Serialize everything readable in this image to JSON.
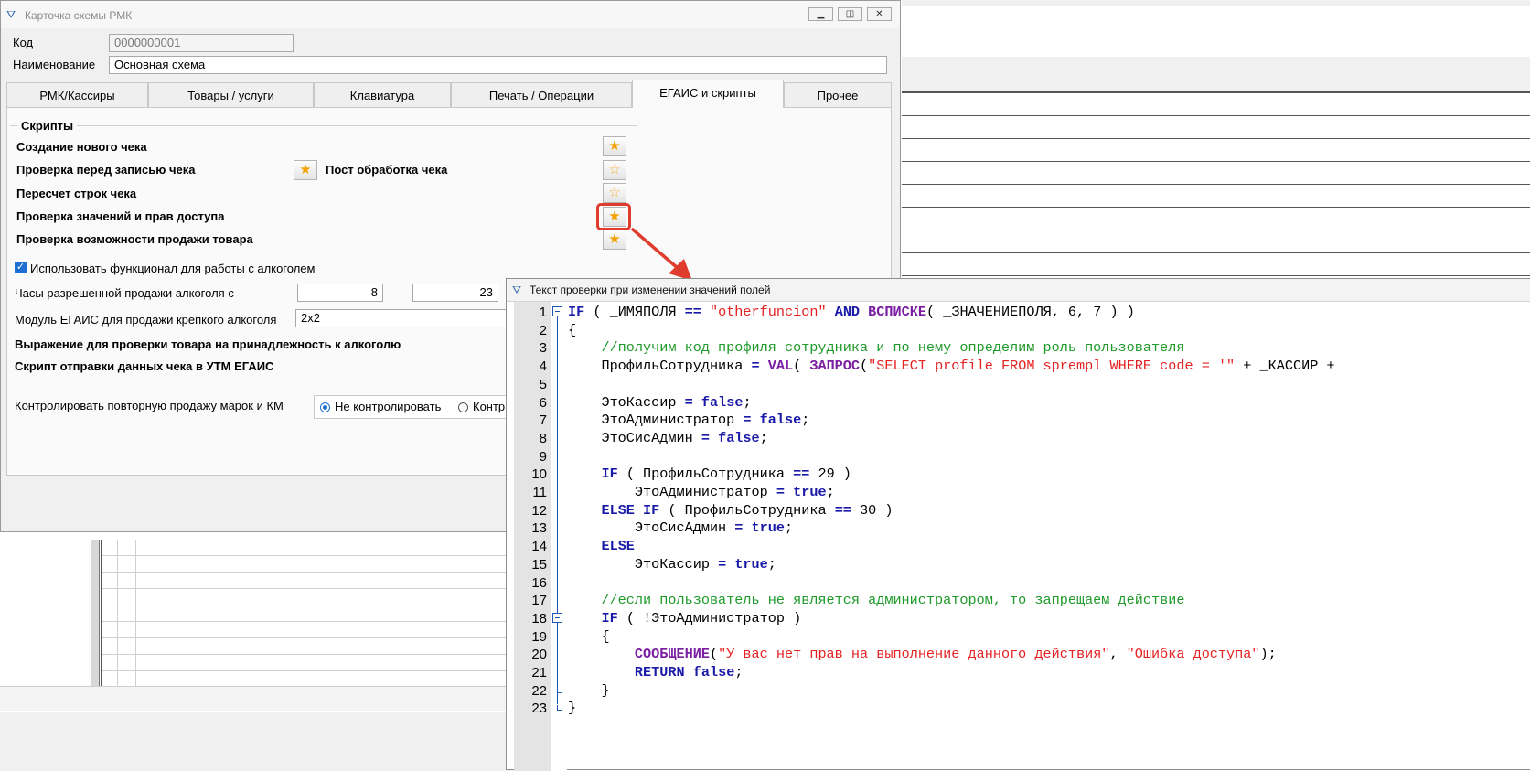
{
  "main_window": {
    "title": "Карточка схемы РМК",
    "code_label": "Код",
    "code_value": "0000000001",
    "name_label": "Наименование",
    "name_value": "Основная схема",
    "tabs": [
      "РМК/Кассиры",
      "Товары / услуги",
      "Клавиатура",
      "Печать / Операции",
      "ЕГАИС и скрипты",
      "Прочее"
    ],
    "active_tab": "ЕГАИС и скрипты",
    "scripts_group": "Скрипты",
    "scripts": [
      "Создание нового чека",
      "Проверка перед записью чека",
      "Пересчет строк чека",
      "Проверка значений и прав доступа",
      "Проверка возможности продажи товара"
    ],
    "post_processing_label": "Пост обработка чека",
    "alcohol_checkbox_label": "Использовать функционал для работы с алкоголем",
    "alcohol_checkbox_checked": true,
    "hours_label": "Часы разрешенной продажи алкоголя с",
    "hours_from": "8",
    "hours_to": "23",
    "module_label": "Модуль ЕГАИС для продажи крепкого алкоголя",
    "module_value": "2x2",
    "expr_label": "Выражение для проверки товара на принадлежность к алкоголю",
    "utm_label": "Скрипт отправки данных чека в УТМ ЕГАИС",
    "control_label": "Контролировать повторную продажу марок и КМ",
    "control_options": [
      "Не контролировать",
      "Контр"
    ],
    "control_selected": "Не контролировать"
  },
  "code_editor": {
    "title": "Текст проверки при изменении значений полей",
    "line_numbers": [
      "1",
      "2",
      "3",
      "4",
      "5",
      "6",
      "7",
      "8",
      "9",
      "10",
      "11",
      "12",
      "13",
      "14",
      "15",
      "16",
      "17",
      "18",
      "19",
      "20",
      "21",
      "22",
      "23"
    ],
    "lines": [
      [
        {
          "t": "IF",
          "c": "kw"
        },
        {
          "t": " ( _ИМЯПОЛЯ ",
          "c": ""
        },
        {
          "t": "==",
          "c": "op"
        },
        {
          "t": " ",
          "c": ""
        },
        {
          "t": "\"otherfuncion\"",
          "c": "str"
        },
        {
          "t": " ",
          "c": ""
        },
        {
          "t": "AND",
          "c": "kw"
        },
        {
          "t": " ",
          "c": ""
        },
        {
          "t": "ВСПИСКЕ",
          "c": "fn"
        },
        {
          "t": "( _ЗНАЧЕНИЕПОЛЯ, 6, 7 ) )",
          "c": ""
        }
      ],
      [
        {
          "t": "{",
          "c": ""
        }
      ],
      [
        {
          "t": "    //получим код профиля сотрудника и по нему определим роль пользователя",
          "c": "cmt"
        }
      ],
      [
        {
          "t": "    ПрофильСотрудника ",
          "c": ""
        },
        {
          "t": "=",
          "c": "op"
        },
        {
          "t": " ",
          "c": ""
        },
        {
          "t": "VAL",
          "c": "fn"
        },
        {
          "t": "( ",
          "c": ""
        },
        {
          "t": "ЗАПРОС",
          "c": "fn"
        },
        {
          "t": "(",
          "c": ""
        },
        {
          "t": "\"SELECT profile FROM sprempl WHERE code = '\"",
          "c": "str"
        },
        {
          "t": " + _КАССИР +",
          "c": ""
        }
      ],
      [
        {
          "t": "",
          "c": ""
        }
      ],
      [
        {
          "t": "    ЭтоКассир ",
          "c": ""
        },
        {
          "t": "=",
          "c": "op"
        },
        {
          "t": " ",
          "c": ""
        },
        {
          "t": "false",
          "c": "kw"
        },
        {
          "t": ";",
          "c": ""
        }
      ],
      [
        {
          "t": "    ЭтоАдминистратор ",
          "c": ""
        },
        {
          "t": "=",
          "c": "op"
        },
        {
          "t": " ",
          "c": ""
        },
        {
          "t": "false",
          "c": "kw"
        },
        {
          "t": ";",
          "c": ""
        }
      ],
      [
        {
          "t": "    ЭтоСисАдмин ",
          "c": ""
        },
        {
          "t": "=",
          "c": "op"
        },
        {
          "t": " ",
          "c": ""
        },
        {
          "t": "false",
          "c": "kw"
        },
        {
          "t": ";",
          "c": ""
        }
      ],
      [
        {
          "t": "",
          "c": ""
        }
      ],
      [
        {
          "t": "    ",
          "c": ""
        },
        {
          "t": "IF",
          "c": "kw"
        },
        {
          "t": " ( ПрофильСотрудника ",
          "c": ""
        },
        {
          "t": "==",
          "c": "op"
        },
        {
          "t": " 29 )",
          "c": ""
        }
      ],
      [
        {
          "t": "        ЭтоАдминистратор ",
          "c": ""
        },
        {
          "t": "=",
          "c": "op"
        },
        {
          "t": " ",
          "c": ""
        },
        {
          "t": "true",
          "c": "kw"
        },
        {
          "t": ";",
          "c": ""
        }
      ],
      [
        {
          "t": "    ",
          "c": ""
        },
        {
          "t": "ELSE IF",
          "c": "kw"
        },
        {
          "t": " ( ПрофильСотрудника ",
          "c": ""
        },
        {
          "t": "==",
          "c": "op"
        },
        {
          "t": " 30 )",
          "c": ""
        }
      ],
      [
        {
          "t": "        ЭтоСисАдмин ",
          "c": ""
        },
        {
          "t": "=",
          "c": "op"
        },
        {
          "t": " ",
          "c": ""
        },
        {
          "t": "true",
          "c": "kw"
        },
        {
          "t": ";",
          "c": ""
        }
      ],
      [
        {
          "t": "    ",
          "c": ""
        },
        {
          "t": "ELSE",
          "c": "kw"
        }
      ],
      [
        {
          "t": "        ЭтоКассир ",
          "c": ""
        },
        {
          "t": "=",
          "c": "op"
        },
        {
          "t": " ",
          "c": ""
        },
        {
          "t": "true",
          "c": "kw"
        },
        {
          "t": ";",
          "c": ""
        }
      ],
      [
        {
          "t": "",
          "c": ""
        }
      ],
      [
        {
          "t": "    //если пользователь не является администратором, то запрещаем действие",
          "c": "cmt"
        }
      ],
      [
        {
          "t": "    ",
          "c": ""
        },
        {
          "t": "IF",
          "c": "kw"
        },
        {
          "t": " ( !ЭтоАдминистратор )",
          "c": ""
        }
      ],
      [
        {
          "t": "    {",
          "c": ""
        }
      ],
      [
        {
          "t": "        ",
          "c": ""
        },
        {
          "t": "СООБЩЕНИЕ",
          "c": "fn"
        },
        {
          "t": "(",
          "c": ""
        },
        {
          "t": "\"У вас нет прав на выполнение данного действия\"",
          "c": "str"
        },
        {
          "t": ", ",
          "c": ""
        },
        {
          "t": "\"Ошибка доступа\"",
          "c": "str"
        },
        {
          "t": ");",
          "c": ""
        }
      ],
      [
        {
          "t": "        ",
          "c": ""
        },
        {
          "t": "RETURN",
          "c": "kw"
        },
        {
          "t": " ",
          "c": ""
        },
        {
          "t": "false",
          "c": "kw"
        },
        {
          "t": ";",
          "c": ""
        }
      ],
      [
        {
          "t": "    }",
          "c": ""
        }
      ],
      [
        {
          "t": "}",
          "c": ""
        }
      ]
    ]
  },
  "colors": {
    "keyword": "#1a1aa8",
    "function": "#7a1fa2",
    "string": "#e52222",
    "comment": "#1f9a2a",
    "highlight": "#e03c2e",
    "star": "#f2a100"
  }
}
